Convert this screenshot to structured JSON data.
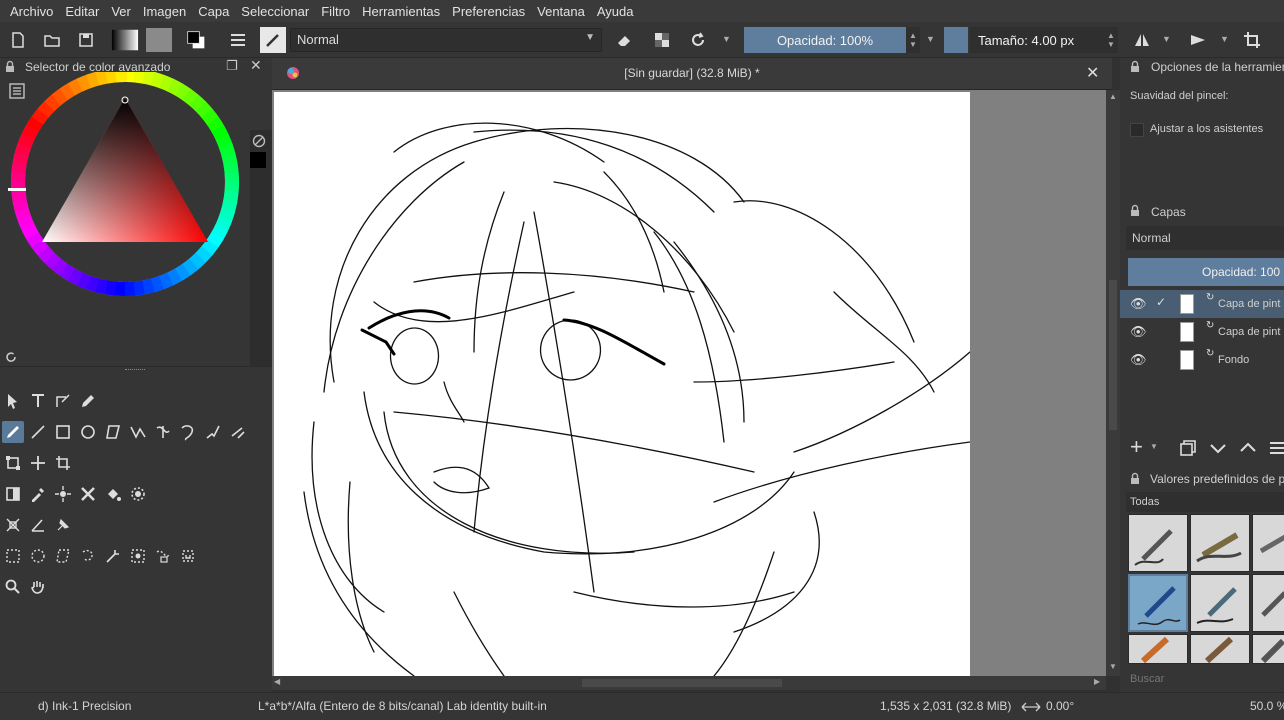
{
  "menubar": {
    "items": [
      "Archivo",
      "Editar",
      "Ver",
      "Imagen",
      "Capa",
      "Seleccionar",
      "Filtro",
      "Herramientas",
      "Preferencias",
      "Ventana",
      "Ayuda"
    ]
  },
  "toolbar": {
    "blend_mode": "Normal",
    "opacity_label": "Opacidad: 100%",
    "size_label": "Tamaño: 4.00 px"
  },
  "color_selector": {
    "title": "Selector de color avanzado"
  },
  "document": {
    "title": "[Sin guardar]  (32.8 MiB) *"
  },
  "tool_options": {
    "title": "Opciones de la herramien",
    "smoothing_label": "Suavidad del pincel:",
    "snap_label": "Ajustar a los asistentes"
  },
  "layers": {
    "title": "Capas",
    "blend_mode": "Normal",
    "opacity_label": "Opacidad:  100",
    "items": [
      {
        "name": "Capa de pint"
      },
      {
        "name": "Capa de pint"
      },
      {
        "name": "Fondo"
      }
    ]
  },
  "presets": {
    "title": "Valores predefinidos de p",
    "filter": "Todas",
    "search_placeholder": "Buscar"
  },
  "status": {
    "brush": "d) Ink-1 Precision",
    "color_space": "L*a*b*/Alfa (Entero de 8 bits/canal)  Lab identity built-in",
    "dimensions": "1,535 x 2,031 (32.8 MiB)",
    "rotation": "0.00°",
    "zoom": "50.0 %"
  },
  "colors": {
    "accent": "#5f7d9c",
    "panel": "#353535",
    "canvas_bg": "#808080"
  }
}
